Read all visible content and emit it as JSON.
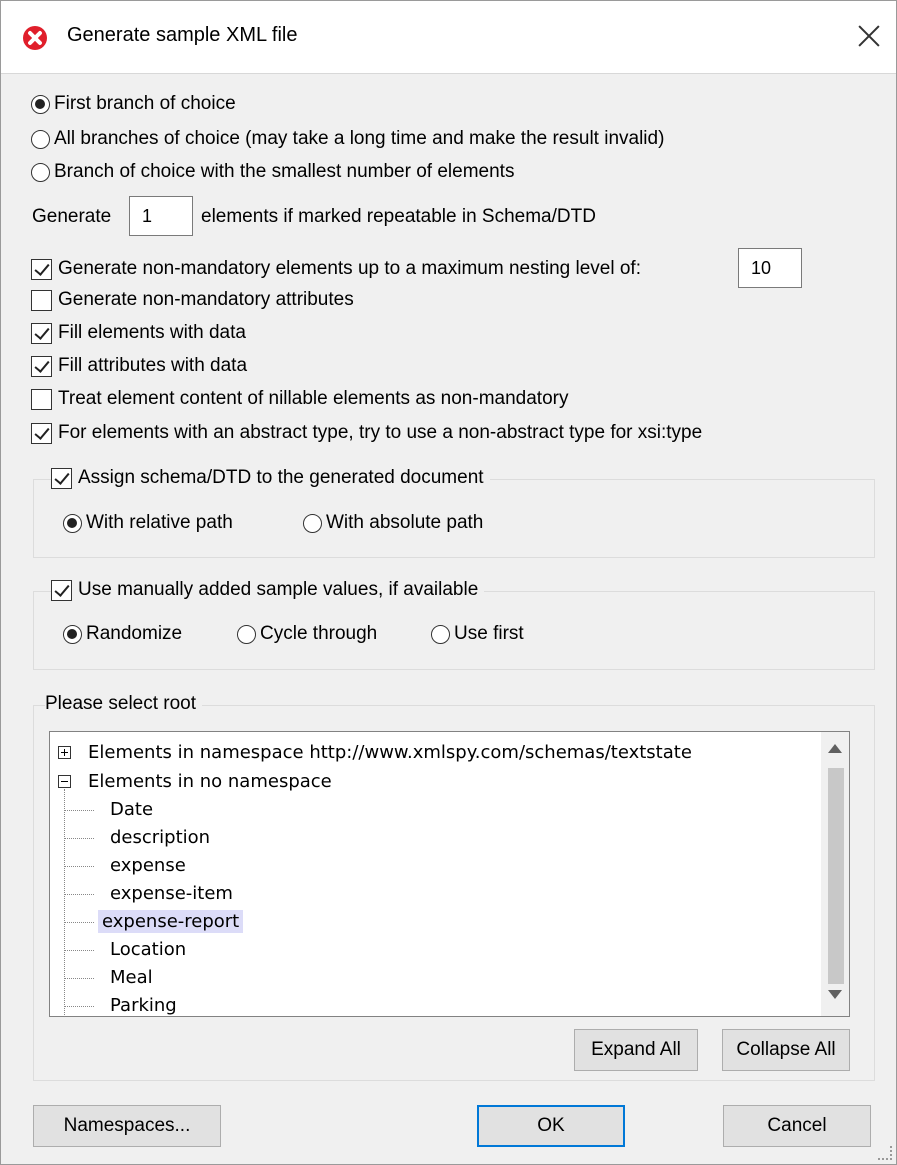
{
  "window": {
    "title": "Generate sample XML file",
    "accent_color": "#e01f2b"
  },
  "choice_options": {
    "first_branch": "First branch of choice",
    "all_branches": "All branches of choice (may take a long time and make the result invalid)",
    "smallest_branch": "Branch of choice with the smallest number of elements",
    "selected": "first_branch"
  },
  "repeat": {
    "prefix": "Generate",
    "value": "1",
    "suffix": "elements if marked repeatable in Schema/DTD"
  },
  "options": {
    "nonmandatory_elements": {
      "label": "Generate non-mandatory elements up to a maximum nesting level of:",
      "checked": true,
      "level": "10"
    },
    "nonmandatory_attributes": {
      "label": "Generate non-mandatory attributes",
      "checked": false
    },
    "fill_elements": {
      "label": "Fill elements with data",
      "checked": true
    },
    "fill_attributes": {
      "label": "Fill attributes with data",
      "checked": true
    },
    "nillable": {
      "label": "Treat element content of nillable elements as non-mandatory",
      "checked": false
    },
    "abstract_type": {
      "label": "For elements with an abstract type, try to use a non-abstract type for xsi:type",
      "checked": true
    }
  },
  "assign_group": {
    "label": "Assign schema/DTD to the generated document",
    "checked": true,
    "relative": "With relative path",
    "absolute": "With absolute path",
    "selected": "relative"
  },
  "sample_group": {
    "label": "Use manually added sample values, if available",
    "checked": true,
    "randomize": "Randomize",
    "cycle": "Cycle through",
    "use_first": "Use first",
    "selected": "randomize"
  },
  "root_group": {
    "label": "Please select root",
    "namespace_node": "Elements in namespace http://www.xmlspy.com/schemas/textstate",
    "no_namespace_node": "Elements in no namespace",
    "items": [
      "Date",
      "description",
      "expense",
      "expense-item",
      "expense-report",
      "Location",
      "Meal",
      "Parking"
    ],
    "selected": "expense-report",
    "expand_all": "Expand All",
    "collapse_all": "Collapse All"
  },
  "footer": {
    "namespaces": "Namespaces...",
    "ok": "OK",
    "cancel": "Cancel"
  }
}
